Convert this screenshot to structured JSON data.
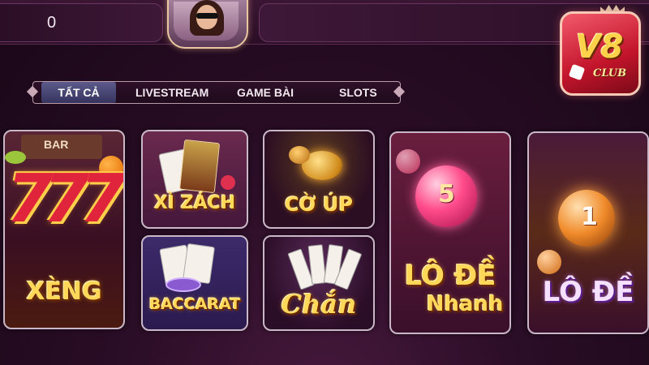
{
  "balance": {
    "value": "0"
  },
  "logo": {
    "text": "V8",
    "subtext": "CLUB"
  },
  "tabs": [
    {
      "label": "TẤT CẢ",
      "active": true
    },
    {
      "label": "LIVESTREAM",
      "active": false
    },
    {
      "label": "GAME BÀI",
      "active": false
    },
    {
      "label": "SLOTS",
      "active": false
    }
  ],
  "games": {
    "xeng": {
      "label": "XÈNG",
      "reel_text": "BAR",
      "reel_number": "777"
    },
    "xi_zach": {
      "label": "XÌ ZÁCH"
    },
    "co_up": {
      "label": "CỜ ÚP"
    },
    "baccarat": {
      "label": "BACCARAT"
    },
    "chan": {
      "label": "Chắn"
    },
    "lo_de_nhanh": {
      "label": "LÔ ĐỀ",
      "label_sub": "Nhanh",
      "ball_number": "5"
    },
    "lo_de": {
      "label": "LÔ ĐỀ",
      "ball_number": "1"
    }
  },
  "colors": {
    "background": "#2a0d26",
    "gold_text": "#ffd85a",
    "tab_active": "#4a4878",
    "logo_red": "#c2142b"
  }
}
